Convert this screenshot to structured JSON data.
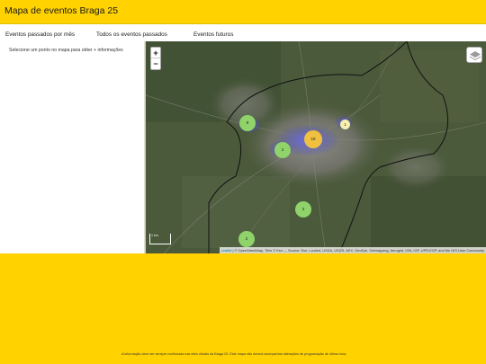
{
  "header": {
    "title": "Mapa de eventos Braga 25"
  },
  "tabs": [
    {
      "label": "Eventos passados por mês"
    },
    {
      "label": "Todos os eventos passados"
    },
    {
      "label": "Eventos futuros"
    }
  ],
  "sidebar": {
    "hint": "Selecione um ponto no mapa para obter + informações"
  },
  "map": {
    "zoom_in": "+",
    "zoom_out": "−",
    "layers_icon": "layers-icon",
    "clusters": [
      {
        "count": "9",
        "color": "#8fd36a"
      },
      {
        "count": "2",
        "color": "#8fd36a"
      },
      {
        "count": "18",
        "color": "#f0c040"
      },
      {
        "count": "1",
        "color": "#f5f0b0"
      },
      {
        "count": "3",
        "color": "#8fd36a"
      },
      {
        "count": "2",
        "color": "#8fd36a"
      }
    ],
    "scale": "1 km",
    "attribution_link": "Leaflet",
    "attribution_text": "| © OpenStreetMap, Tiles © Esri — Source: Esri, i-cubed, USDA, USGS, AEX, GeoEye, Getmapping, Aerogrid, IGN, IGP, UPR-EGP, and the GIS User Community"
  },
  "footer": {
    "note": "A informação deve ser sempre confirmada nas sites oficiais da Braga 25. Este mapa não deverá acompanhar alterações de programação de última hora."
  },
  "colors": {
    "brand": "#ffd200",
    "cluster_green": "#8fd36a",
    "cluster_orange": "#f0c040",
    "hotspot": "#e8401c"
  }
}
